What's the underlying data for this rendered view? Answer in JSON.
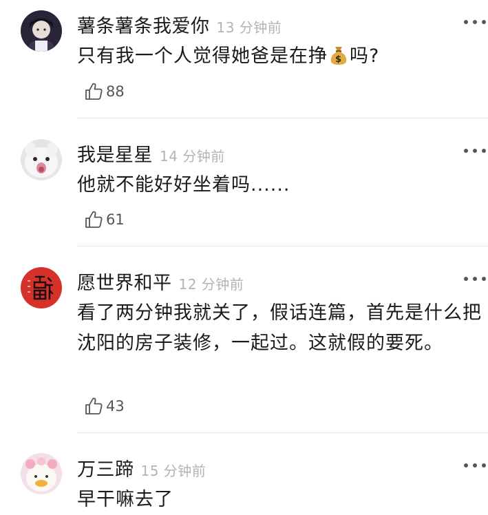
{
  "comments": [
    {
      "username": "薯条薯条我爱你",
      "time": "13 分钟前",
      "text_before": "只有我一个人觉得她爸是在挣",
      "emoji": "money-bag",
      "text_after": "吗?",
      "likes": "88"
    },
    {
      "username": "我是星星",
      "time": "14 分钟前",
      "text": "他就不能好好坐着吗......",
      "likes": "61"
    },
    {
      "username": "愿世界和平",
      "time": "12 分钟前",
      "text": "看了两分钟我就关了，假话连篇，首先是什么把沈阳的房子装修，一起过。这就假的要死。",
      "likes": "43"
    },
    {
      "username": "万三蹄",
      "time": "15 分钟前",
      "text": "早干嘛去了"
    }
  ],
  "colors": {
    "text": "#1a1a1a",
    "time": "#b3b3b3",
    "like": "#555555",
    "divider": "#e6e6e6",
    "fu_red": "#d6322b"
  }
}
